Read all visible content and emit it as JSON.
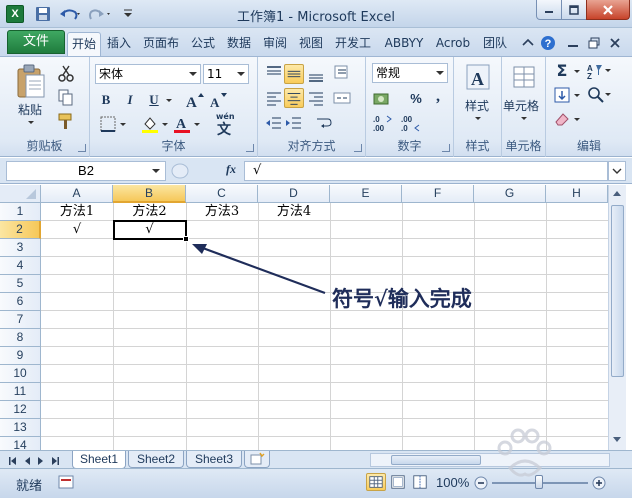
{
  "window": {
    "title": "工作簿1 - Microsoft Excel",
    "app_icon": "X"
  },
  "ribbon": {
    "file_tab": "文件",
    "tabs": [
      "开始",
      "插入",
      "页面布",
      "公式",
      "数据",
      "审阅",
      "视图",
      "开发工",
      "ABBYY",
      "Acrob",
      "团队"
    ],
    "active_tab": "开始",
    "groups": {
      "clipboard": {
        "label": "剪贴板",
        "paste": "粘贴"
      },
      "font": {
        "label": "字体",
        "font_name": "宋体",
        "font_size": "11",
        "bold": "B",
        "italic": "I",
        "underline": "U",
        "wen": "wén",
        "wen_char": "文"
      },
      "alignment": {
        "label": "对齐方式"
      },
      "number": {
        "label": "数字",
        "format": "常规",
        "percent": "%",
        "comma": ","
      },
      "styles": {
        "label": "样式",
        "button": "样式"
      },
      "cells": {
        "label": "单元格",
        "button": "单元格"
      },
      "editing": {
        "label": "编辑",
        "sum": "Σ"
      }
    }
  },
  "formula_bar": {
    "name_box": "B2",
    "fx": "fx",
    "value": "√"
  },
  "sheet": {
    "columns": [
      "A",
      "B",
      "C",
      "D",
      "E",
      "F",
      "G",
      "H"
    ],
    "selected_column": "B",
    "rows": [
      "1",
      "2",
      "3",
      "4",
      "5",
      "6",
      "7",
      "8",
      "9",
      "10",
      "11",
      "12",
      "13",
      "14"
    ],
    "selected_row": "2",
    "cells": {
      "A1": "方法1",
      "B1": "方法2",
      "C1": "方法3",
      "D1": "方法4",
      "A2": "√",
      "B2": "√"
    },
    "annotation": "符号√输入完成"
  },
  "sheet_tabs": {
    "tabs": [
      "Sheet1",
      "Sheet2",
      "Sheet3"
    ],
    "active": "Sheet1"
  },
  "status_bar": {
    "status": "就绪",
    "zoom": "100%",
    "zoom_out": "−",
    "zoom_in": "+"
  }
}
